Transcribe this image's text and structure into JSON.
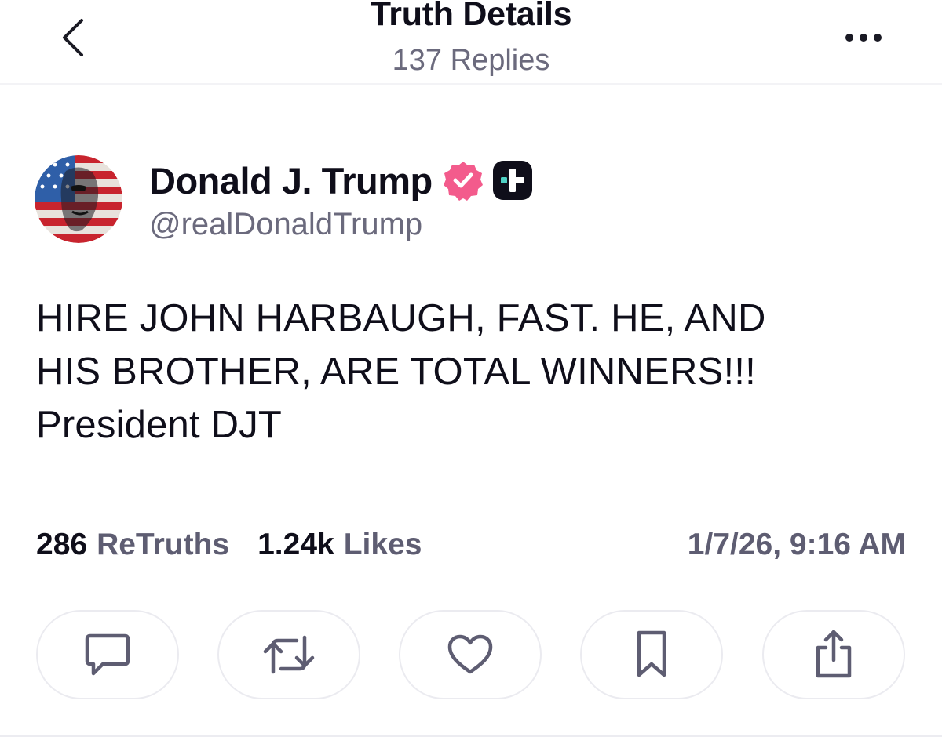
{
  "header": {
    "title": "Truth Details",
    "subtitle": "137 Replies",
    "back_icon": "chevron-left-icon",
    "more_icon": "more-horizontal-icon"
  },
  "author": {
    "name": "Donald J. Trump",
    "handle": "@realDonaldTrump",
    "verified_icon": "verified-badge-icon",
    "verified_color": "#f35b8c",
    "plus_badge_icon": "truth-plus-badge-icon"
  },
  "post": {
    "lines": [
      "HIRE JOHN HARBAUGH, FAST. HE, AND",
      "HIS BROTHER, ARE TOTAL WINNERS!!!",
      "President DJT"
    ]
  },
  "stats": {
    "retruths_count": "286",
    "retruths_label": "ReTruths",
    "likes_count": "1.24k",
    "likes_label": "Likes",
    "timestamp": "1/7/26, 9:16 AM"
  },
  "actions": [
    {
      "icon": "reply-icon"
    },
    {
      "icon": "retruth-icon"
    },
    {
      "icon": "like-heart-icon"
    },
    {
      "icon": "bookmark-icon"
    },
    {
      "icon": "share-icon"
    }
  ],
  "colors": {
    "text_primary": "#0f0e1a",
    "text_secondary": "#6b6a7d",
    "border": "#ebebf0"
  }
}
